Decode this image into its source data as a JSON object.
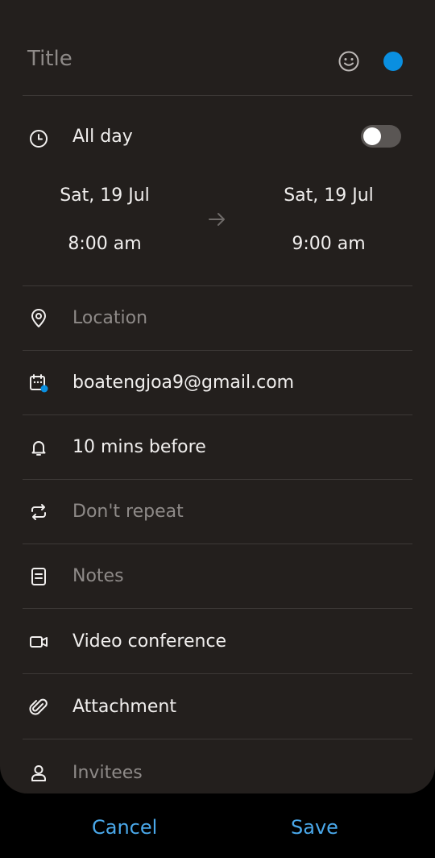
{
  "header": {
    "title_placeholder": "Title",
    "emoji_icon": "smiley-icon",
    "event_color": "#0a8fe0"
  },
  "all_day": {
    "label": "All day",
    "toggle_on": false
  },
  "start": {
    "date": "Sat, 19 Jul",
    "time": "8:00 am"
  },
  "end": {
    "date": "Sat, 19 Jul",
    "time": "9:00 am"
  },
  "fields": {
    "location": "Location",
    "calendar": "boatengjoa9@gmail.com",
    "reminder": "10 mins before",
    "repeat": "Don't repeat",
    "notes": "Notes",
    "video": "Video conference",
    "attachment": "Attachment",
    "invitees": "Invitees"
  },
  "buttons": {
    "cancel": "Cancel",
    "save": "Save"
  },
  "colors": {
    "background": "#231f1d",
    "accent": "#4aa8ea"
  }
}
